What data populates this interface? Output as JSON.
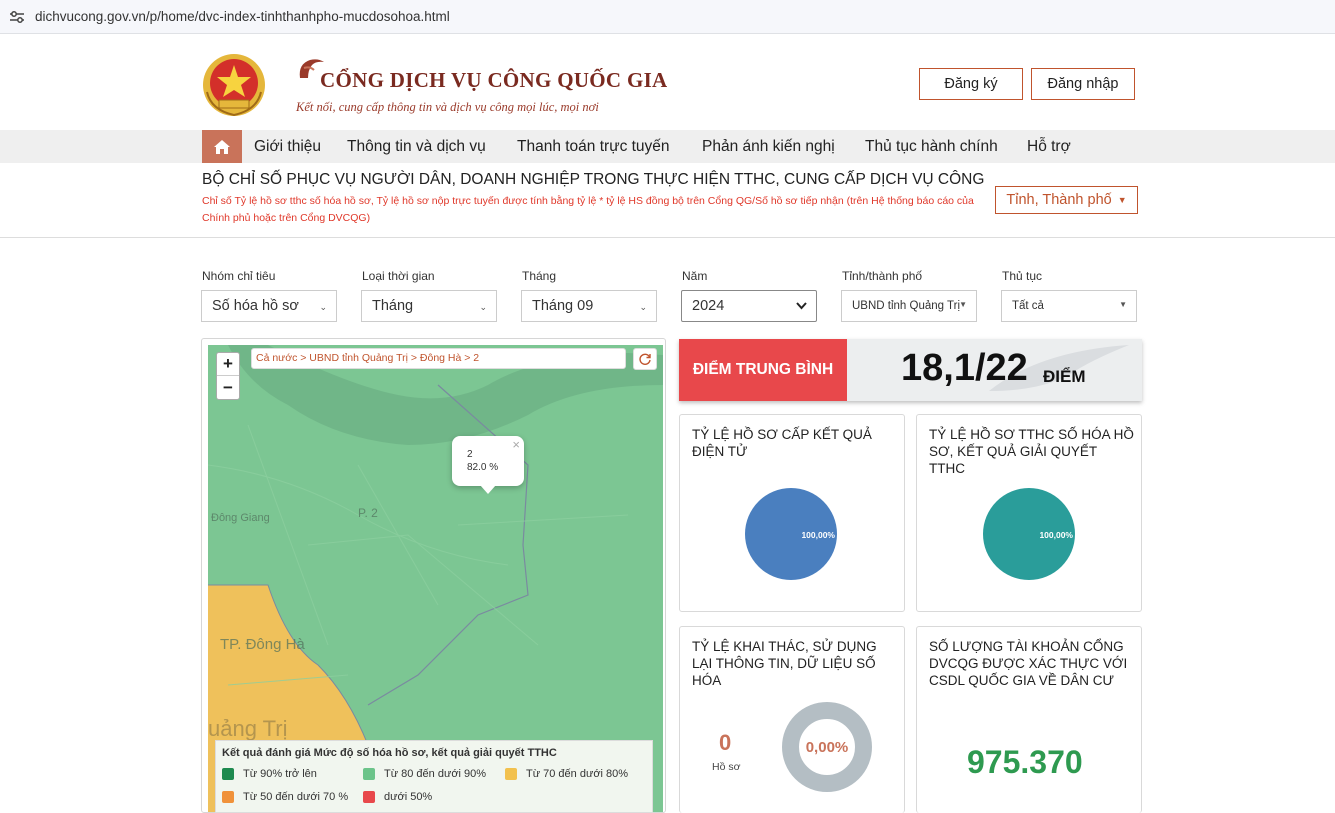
{
  "browser": {
    "url": "dichvucong.gov.vn/p/home/dvc-index-tinhthanhpho-mucdosohoa.html"
  },
  "header": {
    "title": "CỔNG DỊCH VỤ CÔNG QUỐC GIA",
    "slogan": "Kết nối, cung cấp thông tin và dịch vụ công mọi lúc, mọi nơi",
    "register": "Đăng ký",
    "login": "Đăng nhập"
  },
  "nav": [
    "Giới thiệu",
    "Thông tin và dịch vụ",
    "Thanh toán trực tuyến",
    "Phản ánh kiến nghị",
    "Thủ tục hành chính",
    "Hỗ trợ"
  ],
  "index": {
    "title": "BỘ CHỈ SỐ PHỤC VỤ NGƯỜI DÂN, DOANH NGHIỆP TRONG THỰC HIỆN TTHC, CUNG CẤP DỊCH VỤ CÔNG",
    "note": "Chỉ số Tỷ lệ hồ sơ tthc số hóa hồ sơ, Tỷ lệ hồ sơ nộp trực tuyến được tính bằng tỷ lệ * tỷ lệ HS đồng bộ trên Cổng QG/Số hồ sơ tiếp nhận (trên Hệ thống báo cáo của Chính phủ hoặc trên Cổng DVCQG)",
    "scope_button": "Tỉnh, Thành phố"
  },
  "filters": [
    {
      "label": "Nhóm chỉ tiêu",
      "value": "Số hóa hồ sơ"
    },
    {
      "label": "Loại thời gian",
      "value": "Tháng"
    },
    {
      "label": "Tháng",
      "value": "Tháng 09"
    },
    {
      "label": "Năm",
      "value": "2024"
    },
    {
      "label": "Tỉnh/thành phố",
      "value": "UBND tỉnh Quảng Trị"
    },
    {
      "label": "Thủ tục",
      "value": "Tất cả"
    }
  ],
  "map": {
    "breadcrumb": "Cả nước > UBND tỉnh Quảng Trị > Đông Hà > 2",
    "popup": {
      "name": "2",
      "value": "82.0 %"
    },
    "labels": [
      "P. 2",
      "Đông Giang",
      "TP. Đông Hà",
      "uảng Trị"
    ],
    "legend": {
      "title": "Kết quả đánh giá Mức độ số hóa hồ sơ, kết quả giải quyết TTHC",
      "items": [
        {
          "label": "Từ 90% trở lên",
          "color": "#1e8a4f"
        },
        {
          "label": "Từ 80 đến dưới 90%",
          "color": "#6cc48a"
        },
        {
          "label": "Từ 70 đến dưới 80%",
          "color": "#f2c14e"
        },
        {
          "label": "Từ 50 đến dưới 70 %",
          "color": "#f0923a"
        },
        {
          "label": "dưới 50%",
          "color": "#e8484b"
        }
      ]
    }
  },
  "score": {
    "label": "ĐIỂM TRUNG BÌNH",
    "value": "18,1/22",
    "unit": "ĐIỂM"
  },
  "cards": {
    "c1": {
      "title": "TỶ LỆ HỒ SƠ CẤP KẾT QUẢ ĐIỆN TỬ",
      "pie_label": "100,00%",
      "color": "#4a7fbf"
    },
    "c2": {
      "title": "TỶ LỆ HỒ SƠ TTHC SỐ HÓA HỒ SƠ, KẾT QUẢ GIẢI QUYẾT TTHC",
      "pie_label": "100,00%",
      "color": "#2a9d9a"
    },
    "c3": {
      "title": "TỶ LỆ KHAI THÁC, SỬ DỤNG LẠI THÔNG TIN, DỮ LIỆU SỐ HÓA",
      "count": "0",
      "count_label": "Hồ sơ",
      "donut_label": "0,00%"
    },
    "c4": {
      "title": "SỐ LƯỢNG TÀI KHOẢN CỔNG DVCQG ĐƯỢC XÁC THỰC VỚI CSDL QUỐC GIA VỀ DÂN CƯ",
      "value": "975.370"
    }
  }
}
